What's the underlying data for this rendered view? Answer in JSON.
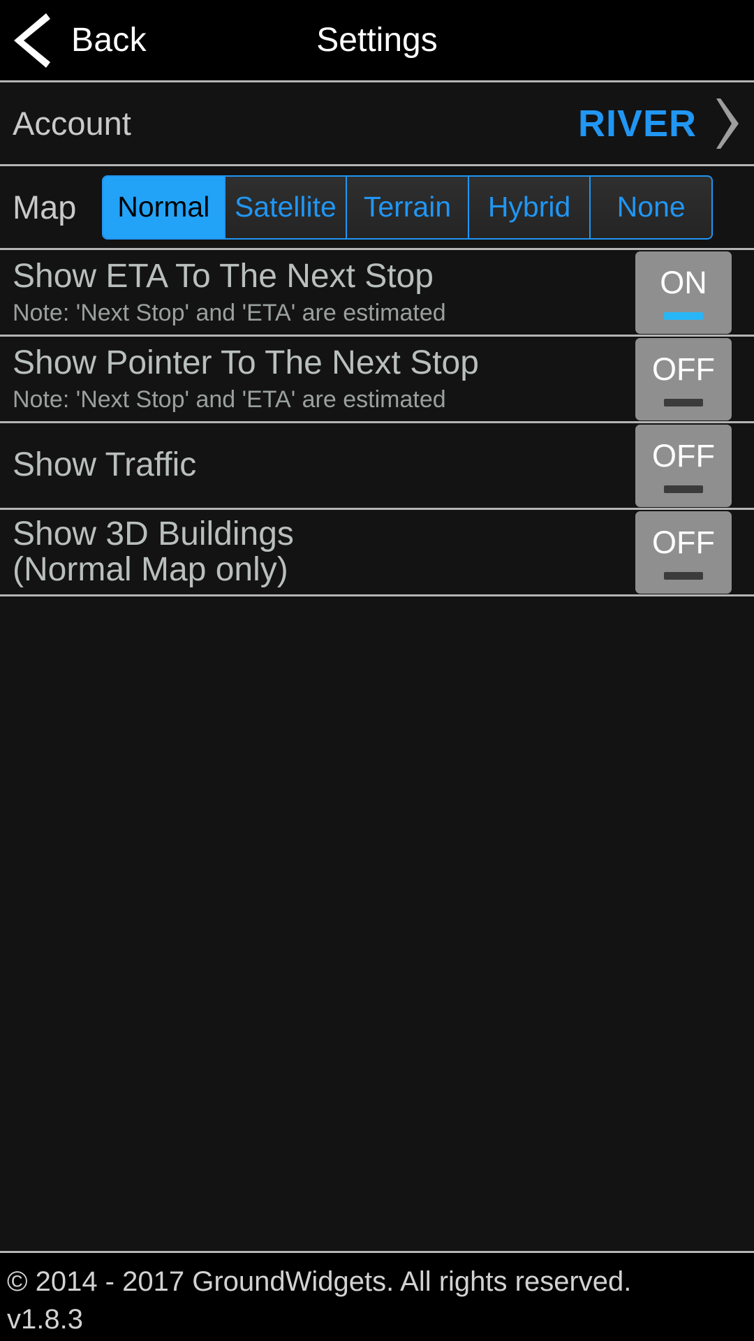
{
  "header": {
    "back_label": "Back",
    "title": "Settings",
    "back_icon": "chevron-left-icon"
  },
  "account": {
    "label": "Account",
    "value": "RIVER",
    "chevron_icon": "chevron-right-icon"
  },
  "map": {
    "label": "Map",
    "options": [
      "Normal",
      "Satellite",
      "Terrain",
      "Hybrid",
      "None"
    ],
    "selected": "Normal"
  },
  "settings": [
    {
      "title": "Show ETA To The Next Stop",
      "note": "Note: 'Next Stop' and 'ETA' are estimated",
      "state": "ON"
    },
    {
      "title": "Show Pointer To The Next Stop",
      "note": "Note: 'Next Stop' and 'ETA' are estimated",
      "state": "OFF"
    },
    {
      "title": "Show Traffic",
      "note": "",
      "state": "OFF"
    },
    {
      "title": "Show 3D Buildings",
      "title_line2": "(Normal Map only)",
      "note": "",
      "state": "OFF"
    }
  ],
  "footer": {
    "copyright": "© 2014 - 2017 GroundWidgets. All rights reserved.",
    "version": "v1.8.3"
  },
  "colors": {
    "accent_blue": "#2196f3",
    "selected_blue": "#23a3f7",
    "toggle_on_bar": "#29b6f6",
    "toggle_off_bar": "#3b3b3b",
    "toggle_bg": "#8f8f8f",
    "text_primary": "#b9bfbd",
    "divider": "#b5b5b5"
  }
}
